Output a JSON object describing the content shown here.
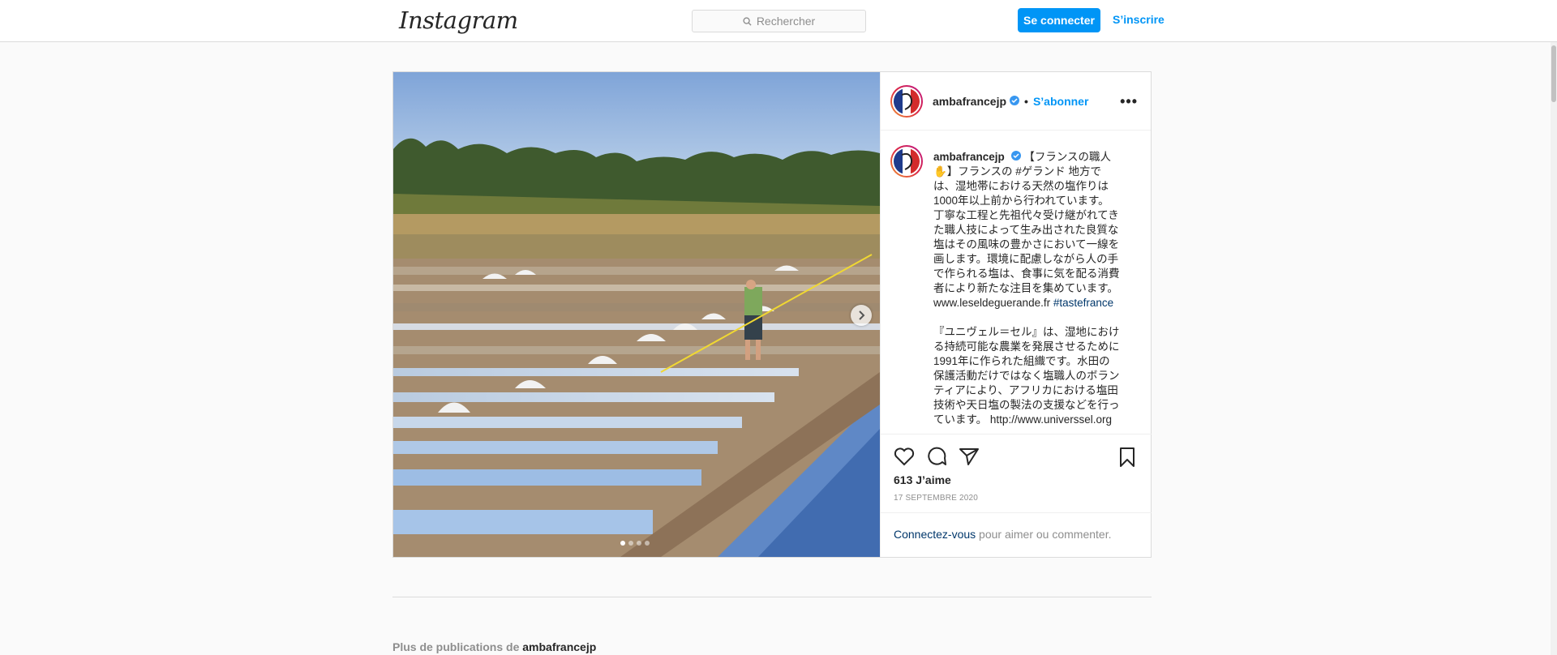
{
  "header": {
    "logo": "Instagram",
    "search_placeholder": "Rechercher",
    "login_label": "Se connecter",
    "signup_label": "S’inscrire"
  },
  "post": {
    "username": "ambafrancejp",
    "follow_label": "S’abonner",
    "separator": "•",
    "more_label": "•••",
    "caption_lines_1": [
      "【フランスの職人",
      "✋】フランスの #ゲランド 地方で",
      "は、湿地帯における天然の塩作りは",
      "1000年以上前から行われています。",
      "丁寧な工程と先祖代々受け継がれてき",
      "た職人技によって生み出された良質な",
      "塩はその風味の豊かさにおいて一線を",
      "画します。環境に配慮しながら人の手",
      "で作られる塩は、食事に気を配る消費",
      "者により新たな注目を集めています。"
    ],
    "caption_link": "www.leseldeguerande.fr",
    "caption_tag": "#tastefrance",
    "caption_lines_2": [
      "『ユニヴェル＝セル』は、湿地におけ",
      "る持続可能な農業を発展させるために",
      "1991年に作られた組織です。水田の",
      "保護活動だけではなく塩職人のボラン",
      "ティアにより、アフリカにおける塩田",
      "技術や天日塩の製法の支援などを行っ"
    ],
    "caption_last_prefix": "ています。",
    "caption_last_link": "http://www.universsel.org",
    "likes": "613 J’aime",
    "date": "17 SEPTEMBRE 2020",
    "login_link": "Connectez-vous",
    "login_suffix": " pour aimer ou commenter."
  },
  "more_from": {
    "prefix": "Plus de publications de ",
    "username": "ambafrancejp"
  },
  "colors": {
    "accent": "#0095f6",
    "link": "#00376b",
    "muted": "#8e8e8e"
  }
}
